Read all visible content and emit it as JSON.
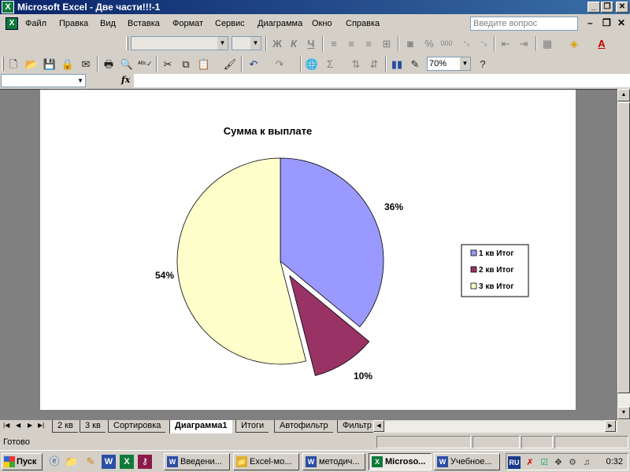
{
  "window": {
    "title": "Microsoft Excel - Две части!!!-1",
    "minimize": "_",
    "restore": "❐",
    "close": "✕"
  },
  "menu": {
    "items": [
      "Файл",
      "Правка",
      "Вид",
      "Вставка",
      "Формат",
      "Сервис",
      "Диаграмма",
      "Окно",
      "Справка"
    ],
    "help_placeholder": "Введите вопрос",
    "doc_minimize": "–",
    "doc_restore": "❐",
    "doc_close": "✕"
  },
  "format_toolbar": {
    "bold": "Ж",
    "italic": "К",
    "underline": "Ч",
    "percent": "%",
    "thousands": "000"
  },
  "standard_toolbar": {
    "zoom": "70%",
    "sum": "Σ",
    "help": "?"
  },
  "formula_bar": {
    "fx": "fx"
  },
  "chart": {
    "title": "Сумма к выплате",
    "slices": [
      {
        "legend": "1 кв Итог",
        "label": "36%",
        "color": "#9999ff"
      },
      {
        "legend": "2 кв Итог",
        "label": "10%",
        "color": "#993366"
      },
      {
        "legend": "3 кв Итог",
        "label": "54%",
        "color": "#ffffcc"
      }
    ]
  },
  "chart_data": {
    "type": "pie",
    "title": "Сумма к выплате",
    "categories": [
      "1 кв Итог",
      "2 кв Итог",
      "3 кв Итог"
    ],
    "values": [
      36,
      10,
      54
    ],
    "labels": [
      "36%",
      "10%",
      "54%"
    ],
    "exploded": [
      "2 кв Итог"
    ],
    "legend": "right",
    "colors": [
      "#9999ff",
      "#993366",
      "#ffffcc"
    ]
  },
  "sheet_tabs": [
    "2 кв",
    "3 кв",
    "Сортировка",
    "Диаграмма1",
    "Итоги",
    "Автофильтр",
    "Фильтр"
  ],
  "active_tab": "Диаграмма1",
  "status": "Готово",
  "taskbar": {
    "start": "Пуск",
    "tasks": [
      {
        "label": "Введени...",
        "icon": "W",
        "color": "#2b4ea5"
      },
      {
        "label": "Excel-мо...",
        "icon": "📁",
        "color": "#e0b030"
      },
      {
        "label": "методич...",
        "icon": "W",
        "color": "#2b4ea5"
      },
      {
        "label": "Microso...",
        "icon": "X",
        "color": "#0f7a3a"
      },
      {
        "label": "Учебное...",
        "icon": "W",
        "color": "#2b4ea5"
      }
    ],
    "lang": "RU",
    "clock": "0:32"
  }
}
